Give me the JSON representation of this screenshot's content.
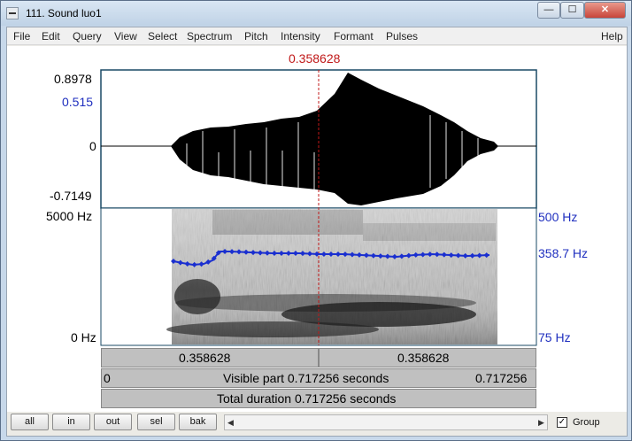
{
  "window": {
    "title": "111. Sound luo1",
    "buttons": {
      "minimize": "—",
      "maximize": "☐",
      "close": "✕"
    }
  },
  "menu": {
    "items": [
      "File",
      "Edit",
      "Query",
      "View",
      "Select",
      "Spectrum",
      "Pitch",
      "Intensity",
      "Formant",
      "Pulses"
    ],
    "help": "Help"
  },
  "cursor": {
    "time_label": "0.358628",
    "time_s": 0.358628
  },
  "waveform": {
    "max_label": "0.8978",
    "mid_label": "0.515",
    "zero_label": "0",
    "min_label": "-0.7149"
  },
  "spectrogram": {
    "top_label": "5000 Hz",
    "bottom_label": "0 Hz"
  },
  "pitch": {
    "top_label": "500 Hz",
    "cursor_label": "358.7 Hz",
    "bottom_label": "75 Hz"
  },
  "bars": {
    "left_time": "0.358628",
    "right_time": "0.358628",
    "visible_start": "0",
    "visible_text": "Visible part 0.717256 seconds",
    "visible_end": "0.717256",
    "total_text": "Total duration 0.717256 seconds"
  },
  "toolbar": {
    "all": "all",
    "in": "in",
    "out": "out",
    "sel": "sel",
    "bak": "bak",
    "scroll_left": "◀",
    "scroll_right": "▶",
    "group_checked": "✓",
    "group_label": "Group"
  },
  "colors": {
    "pitch_line": "#1a2fd0",
    "cursor": "#c01818",
    "text_blue": "#1f2fbf"
  }
}
